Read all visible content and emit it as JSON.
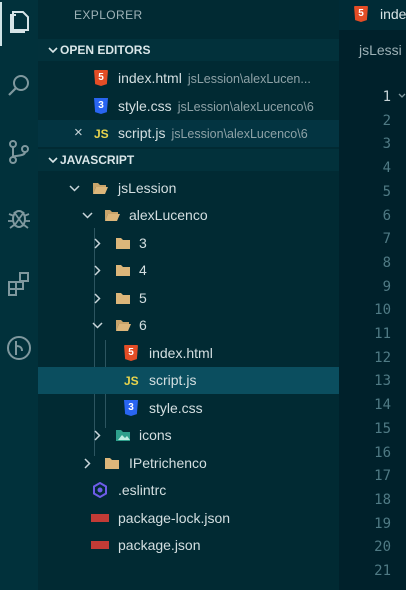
{
  "explorer_title": "EXPLORER",
  "sections": {
    "open_editors": "OPEN EDITORS",
    "javascript": "JAVASCRIPT"
  },
  "open_editors": [
    {
      "name": "index.html",
      "path": "jsLession\\alexLucen...",
      "icon": "html-file-icon"
    },
    {
      "name": "style.css",
      "path": "jsLession\\alexLucenco\\6",
      "icon": "css-file-icon"
    },
    {
      "name": "script.js",
      "path": "jsLession\\alexLucenco\\6",
      "icon": "js-file-icon",
      "close": "×"
    }
  ],
  "tree": [
    {
      "name": "jsLession",
      "icon": "folder-open-icon"
    },
    {
      "name": "alexLucenco",
      "icon": "folder-open-icon"
    },
    {
      "name": "3",
      "icon": "folder-icon"
    },
    {
      "name": "4",
      "icon": "folder-icon"
    },
    {
      "name": "5",
      "icon": "folder-icon"
    },
    {
      "name": "6",
      "icon": "folder-open-icon"
    },
    {
      "name": "index.html",
      "icon": "html-file-icon"
    },
    {
      "name": "script.js",
      "icon": "js-file-icon"
    },
    {
      "name": "style.css",
      "icon": "css-file-icon"
    },
    {
      "name": "icons",
      "icon": "image-folder-icon"
    },
    {
      "name": "IPetrichenco",
      "icon": "folder-icon"
    },
    {
      "name": ".eslintrc",
      "icon": "eslint-icon"
    },
    {
      "name": "package-lock.json",
      "icon": "npm-icon"
    },
    {
      "name": "package.json",
      "icon": "npm-icon"
    }
  ],
  "badges": {
    "html": "5",
    "css": "3",
    "js": "JS"
  },
  "editor": {
    "tab_label": "index",
    "breadcrumb": "jsLessi",
    "line_numbers": [
      "1",
      "2",
      "3",
      "4",
      "5",
      "6",
      "7",
      "8",
      "9",
      "10",
      "11",
      "12",
      "13",
      "14",
      "15",
      "16",
      "17",
      "18",
      "19",
      "20",
      "21"
    ]
  },
  "colors": {
    "background": "#01252e",
    "selection": "#0b4e5f",
    "html": "#e44d26",
    "css": "#2965f1",
    "js": "#e8d44d",
    "folder": "#dcb67a"
  }
}
